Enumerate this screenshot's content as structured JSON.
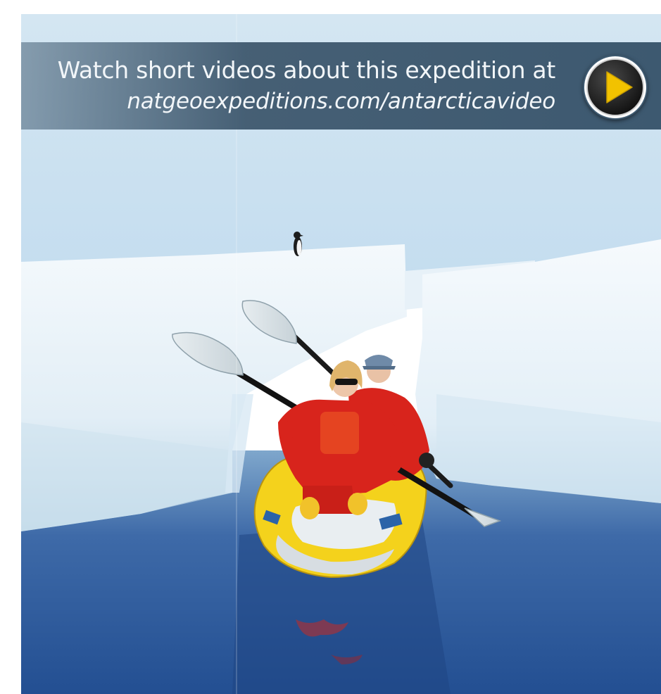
{
  "banner": {
    "line1": "Watch short videos about this expedition at",
    "line2": "natgeoexpeditions.com/antarcticavideo"
  },
  "play_button": {
    "icon": "play-icon",
    "accent_color": "#f2c200",
    "ring_color": "#ffffff"
  },
  "photo": {
    "subject": "kayak-with-two-paddlers",
    "kayak_color": "#f4d21c",
    "suit_color": "#d8241c",
    "water_color": "#2e5d9c",
    "ice_color": "#eef6fb"
  }
}
